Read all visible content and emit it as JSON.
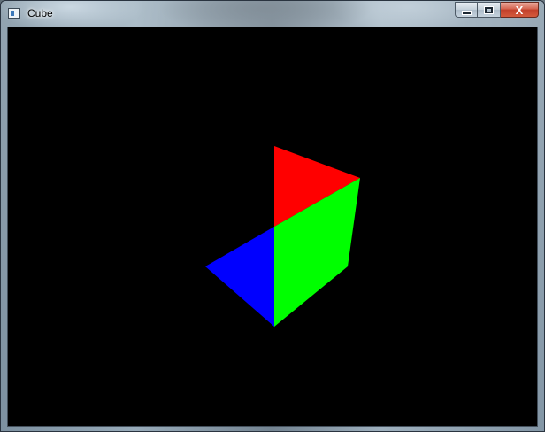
{
  "window": {
    "title": "Cube",
    "icon": "app-window-icon",
    "controls": {
      "minimize_icon": "minimize-icon",
      "maximize_icon": "maximize-icon",
      "close_icon": "close-icon",
      "close_glyph": "X"
    }
  },
  "canvas": {
    "background": "#000000",
    "faces": [
      {
        "name": "red-face",
        "color": "#ff0000"
      },
      {
        "name": "green-face",
        "color": "#00ff00"
      },
      {
        "name": "blue-face",
        "color": "#0000ff"
      }
    ]
  }
}
